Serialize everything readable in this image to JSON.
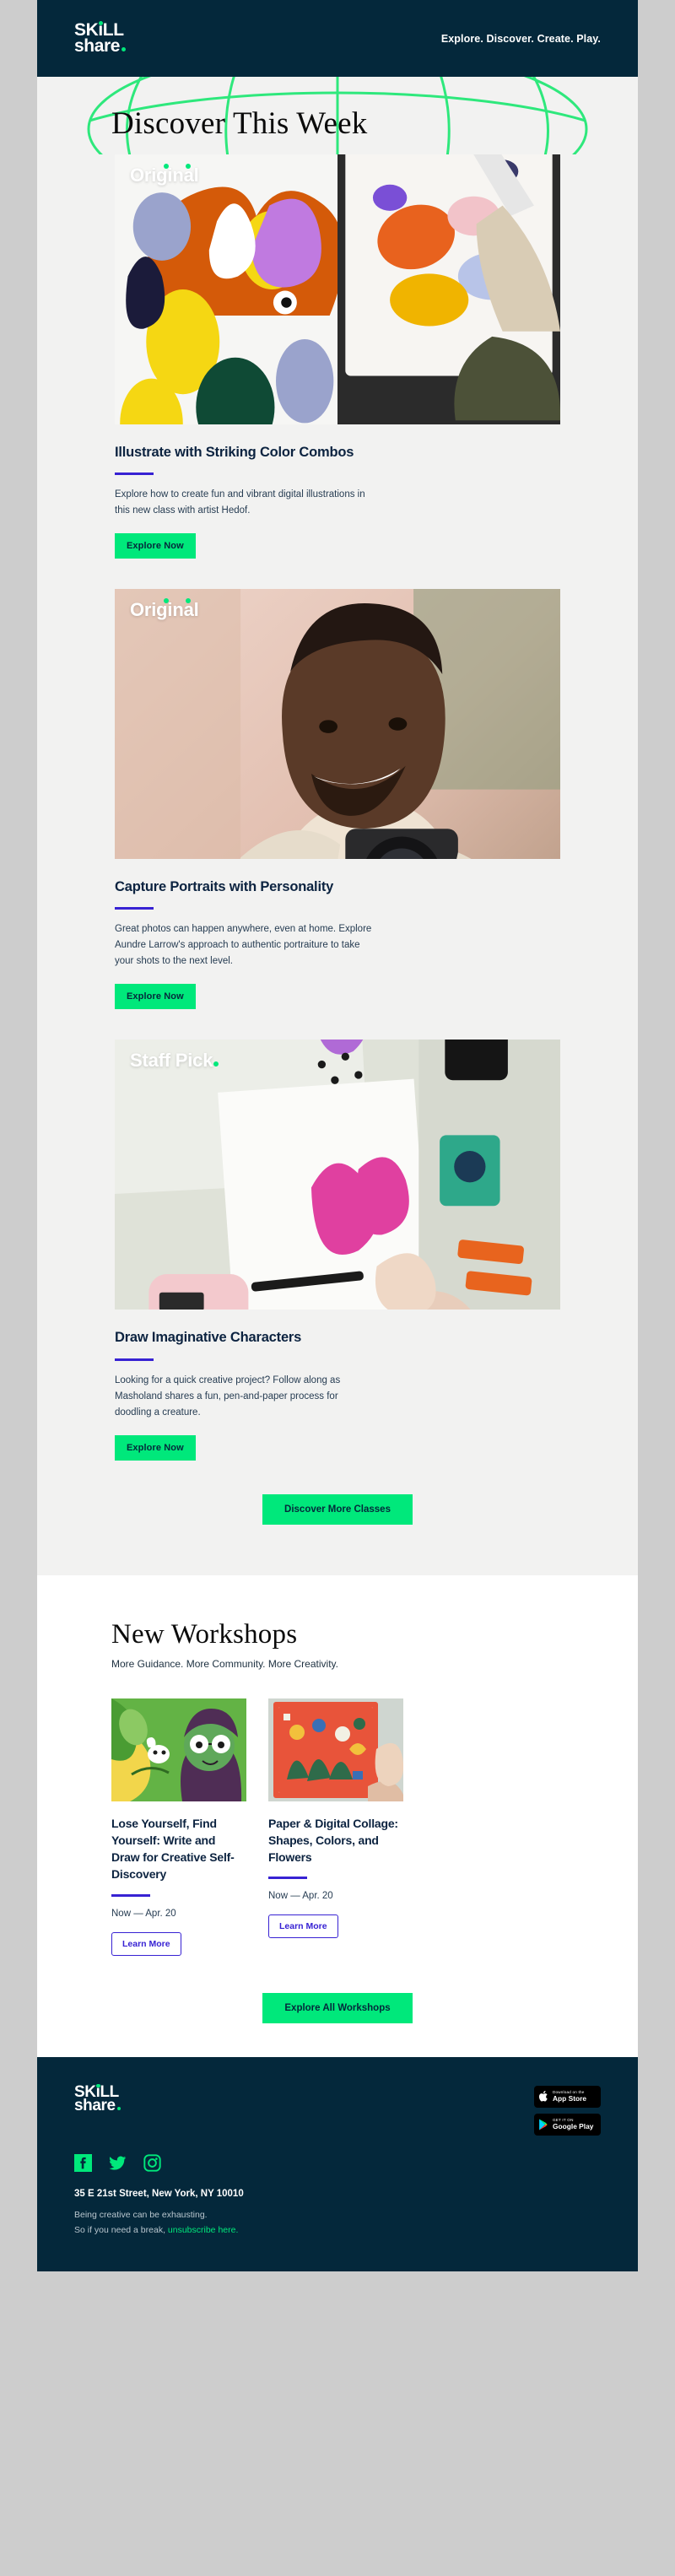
{
  "brand": {
    "logo_line1": "SKiLL",
    "logo_line2": "share",
    "accent_green": "#00e87b",
    "navy": "#04283b",
    "indigo": "#3722d3"
  },
  "header": {
    "tagline": "Explore. Discover. Create. Play."
  },
  "discover": {
    "heading": "Discover This Week",
    "cards": [
      {
        "badge": "Original",
        "badge_type": "original",
        "title": "Illustrate with Striking Color Combos",
        "body": "Explore how to create fun and vibrant digital illustrations in this new class with artist Hedof.",
        "button": "Explore Now"
      },
      {
        "badge": "Original",
        "badge_type": "original",
        "title": "Capture Portraits with Personality",
        "body": "Great photos can happen anywhere, even at home. Explore Aundre Larrow's approach to authentic portraiture to take your shots to the next level.",
        "button": "Explore Now"
      },
      {
        "badge": "Staff Pick",
        "badge_type": "staff",
        "title": "Draw Imaginative Characters",
        "body": "Looking for a quick creative project? Follow along as Masholand shares a fun, pen-and-paper process for doodling a creature.",
        "button": "Explore Now"
      }
    ],
    "cta": "Discover More Classes"
  },
  "workshops": {
    "heading": "New Workshops",
    "subtitle": "More Guidance. More Community. More Creativity.",
    "cards": [
      {
        "title": "Lose Yourself, Find Yourself: Write and Draw for Creative Self-Discovery",
        "date": "Now — Apr. 20",
        "button": "Learn More"
      },
      {
        "title": "Paper & Digital Collage: Shapes, Colors, and Flowers",
        "date": "Now — Apr. 20",
        "button": "Learn More"
      }
    ],
    "cta": "Explore All Workshops"
  },
  "footer": {
    "app_store": {
      "small": "Download on the",
      "large": "App Store"
    },
    "google_play": {
      "small": "GET IT ON",
      "large": "Google Play"
    },
    "socials": [
      "facebook-icon",
      "twitter-icon",
      "instagram-icon"
    ],
    "address": "35 E 21st Street, New York, NY 10010",
    "legal_line1": "Being creative can be exhausting.",
    "legal_line2_pre": "So if you need a break, ",
    "legal_link": "unsubscribe here.",
    "legal_line2_post": ""
  }
}
